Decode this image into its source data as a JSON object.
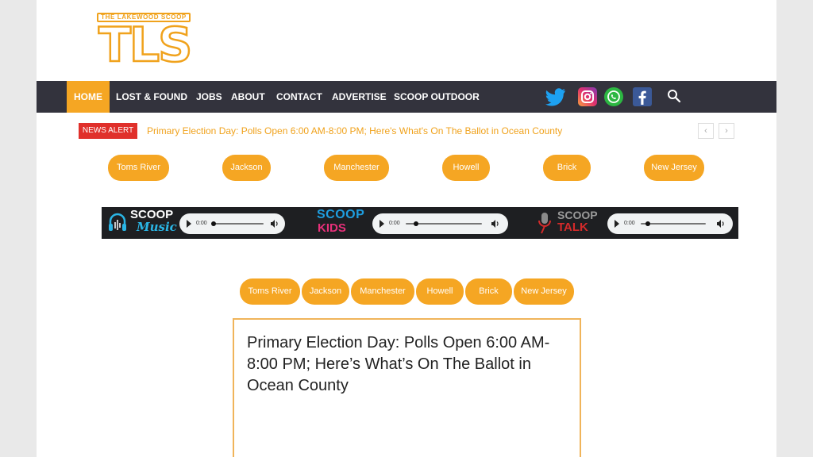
{
  "logo": {
    "top_text": "THE LAKEWOOD SCOOP",
    "main_text": "TLS"
  },
  "nav": {
    "items": [
      {
        "label": "HOME",
        "active": true
      },
      {
        "label": "LOST & FOUND"
      },
      {
        "label": "JOBS"
      },
      {
        "label": "ABOUT"
      },
      {
        "label": "CONTACT"
      },
      {
        "label": "ADVERTISE"
      },
      {
        "label": "SCOOP OUTDOOR"
      }
    ],
    "social": [
      "twitter-icon",
      "instagram-icon",
      "whatsapp-icon",
      "facebook-icon"
    ],
    "colors": {
      "background": "#33333d",
      "active": "#f5a623"
    }
  },
  "news_alert": {
    "badge": "NEWS ALERT",
    "headline": "Primary Election Day: Polls Open 6:00 AM-8:00 PM; Here's What's On The Ballot in Ocean County",
    "prev": "‹",
    "next": "›"
  },
  "towns_top": [
    "Toms River",
    "Jackson",
    "Manchester",
    "Howell",
    "Brick",
    "New Jersey"
  ],
  "audio": {
    "players": [
      {
        "brand_line1": "SCOOP",
        "brand_line2": "Music",
        "time": "0:00"
      },
      {
        "brand_line1": "SCOOP",
        "brand_line2": "KIDS",
        "time": "0:00"
      },
      {
        "brand_line1": "SCOOP",
        "brand_line2": "TALK",
        "time": "0:00"
      }
    ]
  },
  "towns_bottom": [
    "Toms River",
    "Jackson",
    "Manchester",
    "Howell",
    "Brick",
    "New Jersey"
  ],
  "article": {
    "title": "Primary Election Day: Polls Open 6:00 AM-8:00 PM; Here’s What’s On The Ballot in Ocean County"
  }
}
